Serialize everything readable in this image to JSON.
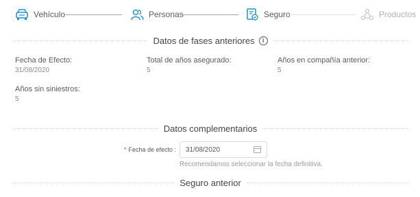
{
  "stepper": {
    "steps": [
      {
        "label": "Vehículo",
        "state": "completed",
        "icon": "car-icon"
      },
      {
        "label": "Personas",
        "state": "completed",
        "icon": "people-icon"
      },
      {
        "label": "Seguro",
        "state": "active",
        "icon": "policy-icon"
      },
      {
        "label": "Productos",
        "state": "pending",
        "icon": "products-icon"
      }
    ],
    "accent": "#1e8fd6",
    "inactive": "#c8c8c8"
  },
  "previous_phases": {
    "title": "Datos de fases anteriores",
    "fields": [
      {
        "label": "Fecha de Efecto:",
        "value": "31/08/2020"
      },
      {
        "label": "Total de años asegurado:",
        "value": "5"
      },
      {
        "label": "Años en compañía anterior:",
        "value": "5"
      },
      {
        "label": "Años sin siniestros:",
        "value": "5"
      }
    ]
  },
  "complementary": {
    "title": "Datos complementarios",
    "effect_date": {
      "label": "Fecha de efecto :",
      "required_mark": "*",
      "value": "31/08/2020",
      "hint": "Recomendamos seleccionar la fecha definitiva."
    }
  },
  "previous_insurance": {
    "title": "Seguro anterior"
  }
}
